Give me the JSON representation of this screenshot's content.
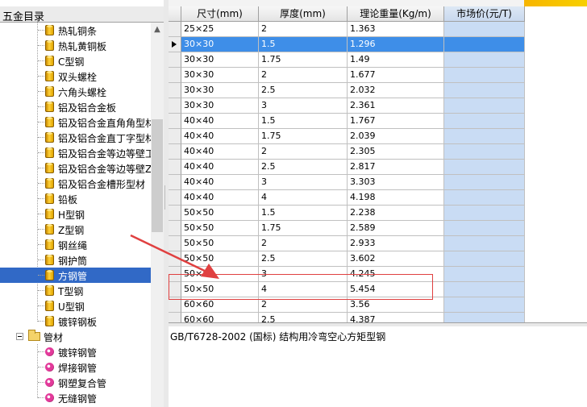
{
  "tree": {
    "header": "五金目录",
    "items": [
      {
        "label": "热轧铜条",
        "icon": "cylinder-icon"
      },
      {
        "label": "热轧黄铜板",
        "icon": "cylinder-icon"
      },
      {
        "label": "C型钢",
        "icon": "cylinder-icon"
      },
      {
        "label": "双头螺栓",
        "icon": "cylinder-icon"
      },
      {
        "label": "六角头螺栓",
        "icon": "cylinder-icon"
      },
      {
        "label": "铝及铝合金板",
        "icon": "cylinder-icon"
      },
      {
        "label": "铝及铝合金直角角型材",
        "icon": "cylinder-icon"
      },
      {
        "label": "铝及铝合金直丁字型材",
        "icon": "cylinder-icon"
      },
      {
        "label": "铝及铝合金等边等壁工字型材",
        "icon": "cylinder-icon"
      },
      {
        "label": "铝及铝合金等边等壁Z字型材",
        "icon": "cylinder-icon"
      },
      {
        "label": "铝及铝合金槽形型材",
        "icon": "cylinder-icon"
      },
      {
        "label": "铅板",
        "icon": "cylinder-icon"
      },
      {
        "label": "H型钢",
        "icon": "cylinder-icon"
      },
      {
        "label": "Z型钢",
        "icon": "cylinder-icon"
      },
      {
        "label": "钢丝绳",
        "icon": "cylinder-icon"
      },
      {
        "label": "钢护筒",
        "icon": "cylinder-icon"
      },
      {
        "label": "方钢管",
        "icon": "cylinder-icon",
        "selected": true
      },
      {
        "label": "T型钢",
        "icon": "cylinder-icon"
      },
      {
        "label": "U型钢",
        "icon": "cylinder-icon"
      },
      {
        "label": "镀锌钢板",
        "icon": "cylinder-icon"
      }
    ],
    "group": {
      "label": "管材",
      "icon": "folder-icon"
    },
    "group_items": [
      {
        "label": "镀锌钢管",
        "icon": "ball-icon"
      },
      {
        "label": "焊接钢管",
        "icon": "ball-icon"
      },
      {
        "label": "钢塑复合管",
        "icon": "ball-icon"
      },
      {
        "label": "无缝钢管",
        "icon": "ball-icon"
      }
    ]
  },
  "grid": {
    "columns": [
      "尺寸(mm)",
      "厚度(mm)",
      "理论重量(Kg/m)",
      "市场价(元/T)"
    ],
    "selected_row": 1,
    "rows": [
      [
        "25×25",
        "2",
        "1.363",
        ""
      ],
      [
        "30×30",
        "1.5",
        "1.296",
        ""
      ],
      [
        "30×30",
        "1.75",
        "1.49",
        ""
      ],
      [
        "30×30",
        "2",
        "1.677",
        ""
      ],
      [
        "30×30",
        "2.5",
        "2.032",
        ""
      ],
      [
        "30×30",
        "3",
        "2.361",
        ""
      ],
      [
        "40×40",
        "1.5",
        "1.767",
        ""
      ],
      [
        "40×40",
        "1.75",
        "2.039",
        ""
      ],
      [
        "40×40",
        "2",
        "2.305",
        ""
      ],
      [
        "40×40",
        "2.5",
        "2.817",
        ""
      ],
      [
        "40×40",
        "3",
        "3.303",
        ""
      ],
      [
        "40×40",
        "4",
        "4.198",
        ""
      ],
      [
        "50×50",
        "1.5",
        "2.238",
        ""
      ],
      [
        "50×50",
        "1.75",
        "2.589",
        ""
      ],
      [
        "50×50",
        "2",
        "2.933",
        ""
      ],
      [
        "50×50",
        "2.5",
        "3.602",
        ""
      ],
      [
        "50×50",
        "3",
        "4.245",
        ""
      ],
      [
        "50×50",
        "4",
        "5.454",
        ""
      ],
      [
        "60×60",
        "2",
        "3.56",
        ""
      ],
      [
        "60×60",
        "2.5",
        "4.387",
        ""
      ]
    ]
  },
  "description": "GB/T6728-2002 (国标) 结构用冷弯空心方矩型钢",
  "colors": {
    "selection": "#3169c6",
    "grid_selection": "#3e8ee8",
    "market_column": "#c9dcf4",
    "annotation": "#e04040"
  }
}
